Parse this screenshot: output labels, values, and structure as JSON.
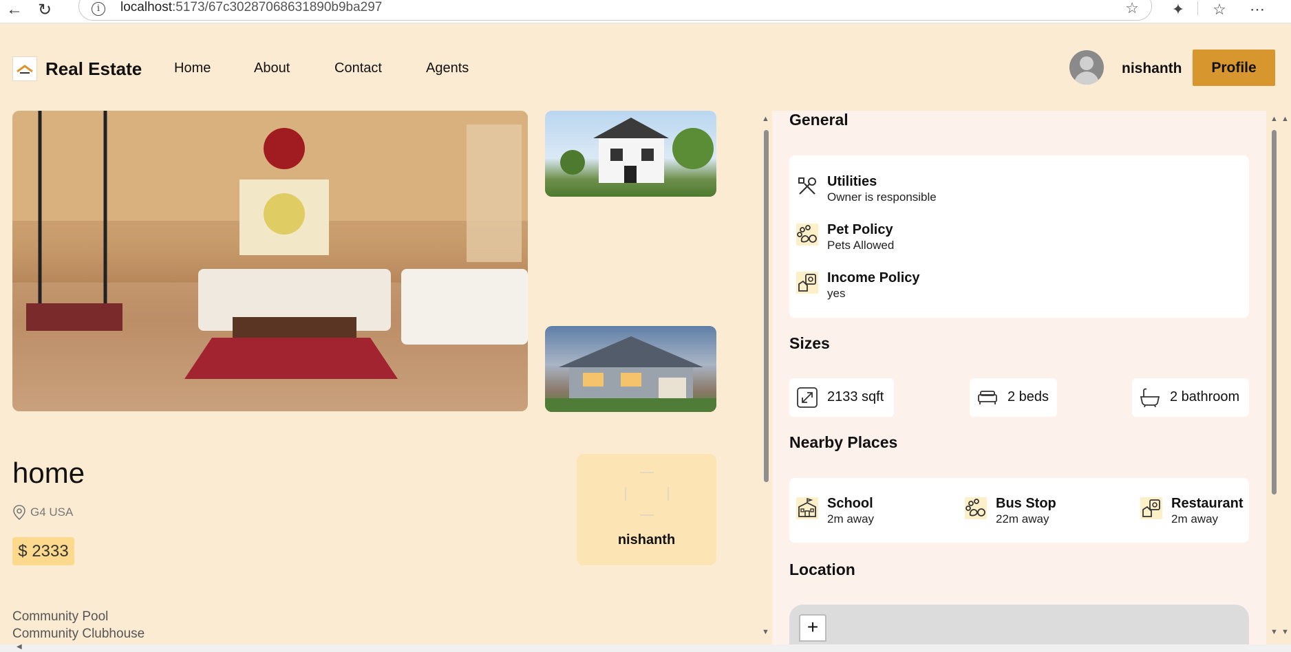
{
  "browser": {
    "url_host": "localhost",
    "url_path": ":5173/67c30287068631890b9ba297"
  },
  "header": {
    "brand": "Real Estate",
    "nav": [
      "Home",
      "About",
      "Contact",
      "Agents"
    ],
    "username": "nishanth",
    "profile_label": "Profile"
  },
  "property": {
    "title": "home",
    "address": "G4 USA",
    "price": "$ 2333",
    "owner_name": "nishanth",
    "amenities": [
      "Community Pool",
      "Community Clubhouse"
    ]
  },
  "panel": {
    "general_title": "General",
    "general": [
      {
        "title": "Utilities",
        "value": "Owner is responsible",
        "icon": "utilities-icon"
      },
      {
        "title": "Pet Policy",
        "value": "Pets Allowed",
        "icon": "paw-icon"
      },
      {
        "title": "Income Policy",
        "value": "yes",
        "icon": "income-icon"
      }
    ],
    "sizes_title": "Sizes",
    "sizes": [
      {
        "label": "2133 sqft",
        "icon": "expand-icon"
      },
      {
        "label": "2 beds",
        "icon": "bed-icon"
      },
      {
        "label": "2 bathroom",
        "icon": "bathtub-icon"
      }
    ],
    "nearby_title": "Nearby Places",
    "nearby": [
      {
        "title": "School",
        "value": "2m away",
        "icon": "school-icon"
      },
      {
        "title": "Bus Stop",
        "value": "22m away",
        "icon": "paw-icon"
      },
      {
        "title": "Restaurant",
        "value": "2m away",
        "icon": "restaurant-icon"
      }
    ],
    "location_title": "Location",
    "map_zoom_in": "+"
  },
  "colors": {
    "page_bg": "#fcebd3",
    "accent": "#d8962e",
    "price_bg": "#fcd98c",
    "owner_card_bg": "#fce4b4",
    "panel_bg": "#fdf1ec"
  }
}
